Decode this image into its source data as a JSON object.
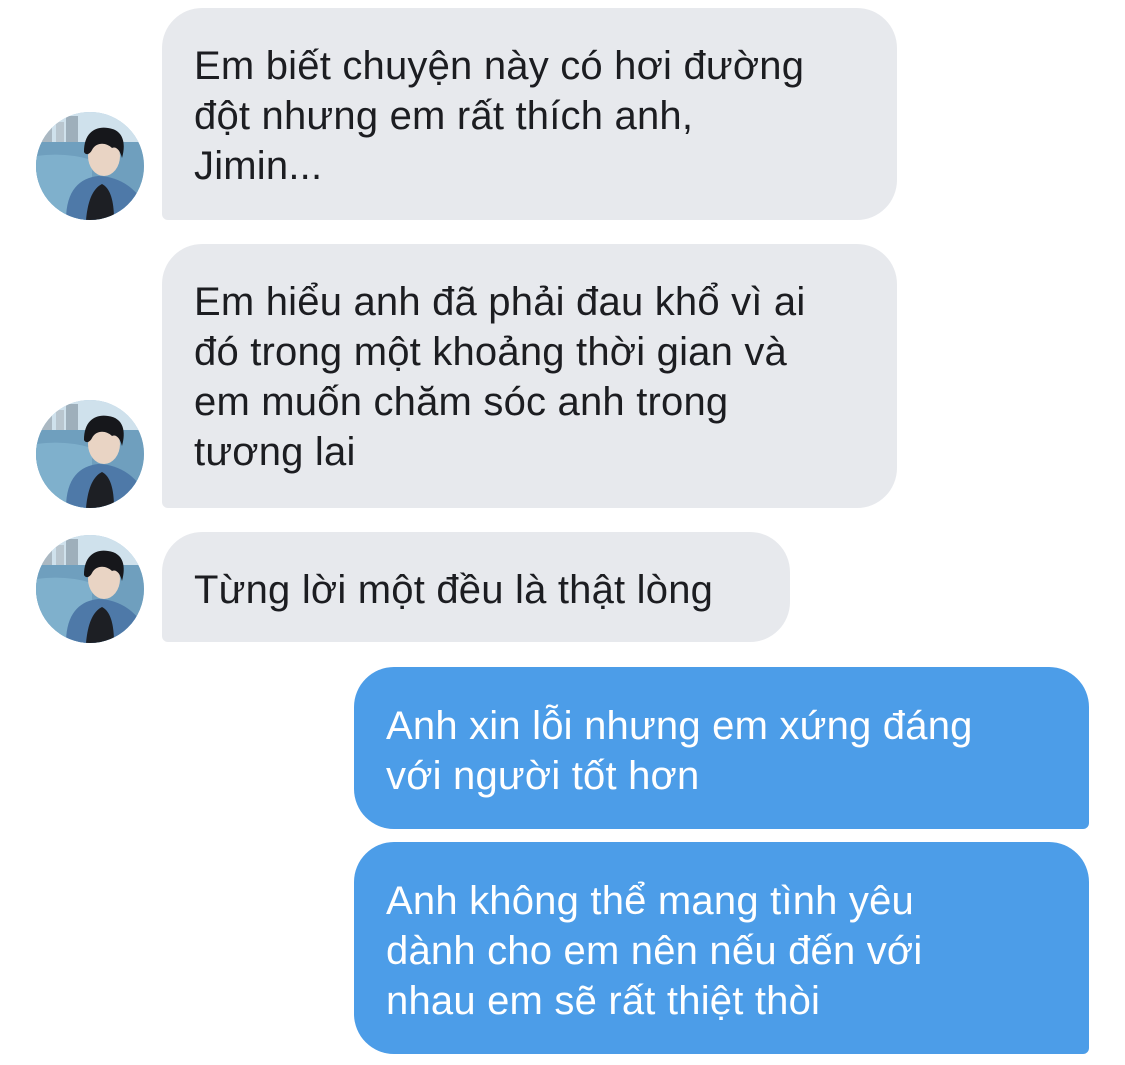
{
  "messages": [
    {
      "sender": "other",
      "text": "Em biết chuyện này có hơi đường\nđột nhưng em rất thích anh,\nJimin..."
    },
    {
      "sender": "other",
      "text": "Em hiểu anh đã phải đau khổ vì ai\nđó trong một khoảng thời gian và\nem muốn chăm sóc anh trong\ntương lai"
    },
    {
      "sender": "other",
      "text": "Từng lời một đều là thật lòng"
    },
    {
      "sender": "me",
      "text": "Anh xin lỗi nhưng em xứng đáng\nvới người tốt hơn"
    },
    {
      "sender": "me",
      "text": "Anh không thể mang tình yêu\ndành cho em nên nếu đến với\nnhau em sẽ rất thiệt thòi"
    }
  ],
  "colors": {
    "incoming_bubble": "#e7e9ed",
    "outgoing_bubble": "#4c9de8",
    "incoming_text": "#1c1d21",
    "outgoing_text": "#ffffff"
  },
  "icons": {
    "avatar": "contact-avatar-photo"
  }
}
